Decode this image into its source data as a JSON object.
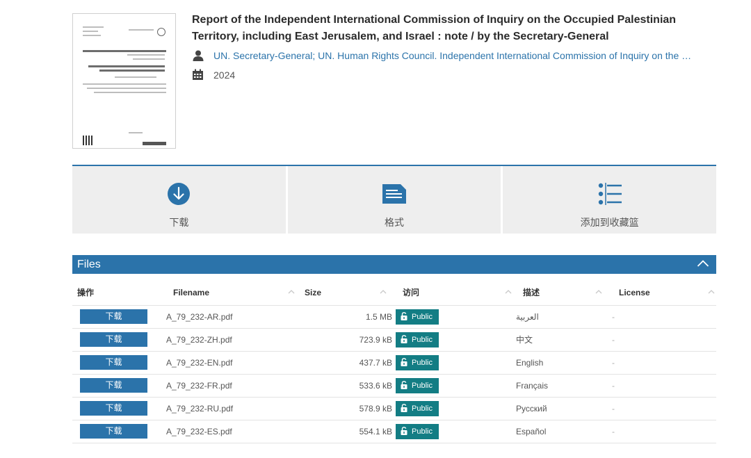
{
  "record": {
    "title": "Report of the Independent International Commission of Inquiry on the Occupied Palestinian Territory, including East Jerusalem, and Israel : note / by the Secretary-General",
    "authors": [
      "UN. Secretary-General",
      "UN. Human Rights Council. Independent International Commission of Inquiry on the O..."
    ],
    "author_separator": ";",
    "date": "2024",
    "icons": {
      "author": "user-icon",
      "date": "calendar-icon"
    }
  },
  "actions": [
    {
      "label": "下载",
      "icon": "download-circle-icon"
    },
    {
      "label": "格式",
      "icon": "document-lines-icon"
    },
    {
      "label": "添加到收藏篮",
      "icon": "list-bullets-icon"
    }
  ],
  "files": {
    "title": "Files",
    "toggle_icon": "chevron-up-icon",
    "columns": [
      "操作",
      "Filename",
      "Size",
      "访问",
      "描述",
      "License"
    ],
    "rows": [
      {
        "action": "下载",
        "filename": "A_79_232-AR.pdf",
        "size": "1.5 MB",
        "access": "Public",
        "description": "العربية",
        "license": "-"
      },
      {
        "action": "下载",
        "filename": "A_79_232-ZH.pdf",
        "size": "723.9 kB",
        "access": "Public",
        "description": "中文",
        "license": "-"
      },
      {
        "action": "下载",
        "filename": "A_79_232-EN.pdf",
        "size": "437.7 kB",
        "access": "Public",
        "description": "English",
        "license": "-"
      },
      {
        "action": "下载",
        "filename": "A_79_232-FR.pdf",
        "size": "533.6 kB",
        "access": "Public",
        "description": "Français",
        "license": "-"
      },
      {
        "action": "下载",
        "filename": "A_79_232-RU.pdf",
        "size": "578.9 kB",
        "access": "Public",
        "description": "Русский",
        "license": "-"
      },
      {
        "action": "下载",
        "filename": "A_79_232-ES.pdf",
        "size": "554.1 kB",
        "access": "Public",
        "description": "Español",
        "license": "-"
      }
    ]
  },
  "colors": {
    "accent": "#2b73aa",
    "public_badge": "#137d84",
    "tile_bg": "#eeeeee"
  }
}
